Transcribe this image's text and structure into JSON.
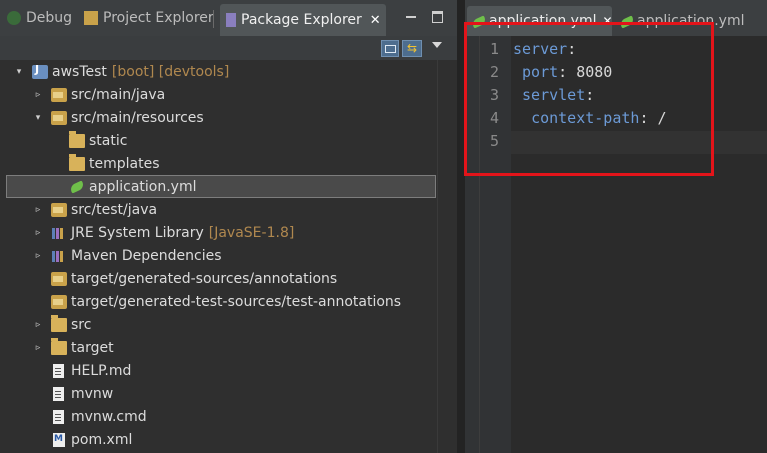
{
  "left_tabs": {
    "debug": "Debug",
    "project_explorer": "Project Explorer",
    "package_explorer": "Package Explorer",
    "close_glyph": "✕"
  },
  "tree": [
    {
      "label": "awsTest",
      "decoration": "[boot] [devtools]",
      "icon": "project-icon",
      "arrow": "▾",
      "indent": 0
    },
    {
      "label": "src/main/java",
      "icon": "source-folder-icon",
      "arrow": "▹",
      "indent": 1
    },
    {
      "label": "src/main/resources",
      "icon": "source-folder-icon",
      "arrow": "▾",
      "indent": 1
    },
    {
      "label": "static",
      "icon": "folder-icon",
      "arrow": "",
      "indent": 2
    },
    {
      "label": "templates",
      "icon": "folder-icon",
      "arrow": "",
      "indent": 2
    },
    {
      "label": "application.yml",
      "icon": "yml-file-icon",
      "arrow": "",
      "indent": 2,
      "selected": true
    },
    {
      "label": "src/test/java",
      "icon": "source-folder-icon",
      "arrow": "▹",
      "indent": 1
    },
    {
      "label": "JRE System Library",
      "decoration": "[JavaSE-1.8]",
      "icon": "library-icon",
      "arrow": "▹",
      "indent": 1
    },
    {
      "label": "Maven Dependencies",
      "icon": "library-icon",
      "arrow": "▹",
      "indent": 1
    },
    {
      "label": "target/generated-sources/annotations",
      "icon": "source-folder-icon",
      "arrow": "",
      "indent": 1
    },
    {
      "label": "target/generated-test-sources/test-annotations",
      "icon": "source-folder-icon",
      "arrow": "",
      "indent": 1
    },
    {
      "label": "src",
      "icon": "folder-icon",
      "arrow": "▹",
      "indent": 1
    },
    {
      "label": "target",
      "icon": "folder-icon",
      "arrow": "▹",
      "indent": 1
    },
    {
      "label": "HELP.md",
      "icon": "file-icon",
      "arrow": "",
      "indent": 1
    },
    {
      "label": "mvnw",
      "icon": "file-icon",
      "arrow": "",
      "indent": 1
    },
    {
      "label": "mvnw.cmd",
      "icon": "file-icon",
      "arrow": "",
      "indent": 1
    },
    {
      "label": "pom.xml",
      "icon": "pom-file-icon",
      "arrow": "",
      "indent": 1
    }
  ],
  "editor_tabs": [
    {
      "label": "application.yml",
      "close_glyph": "✕",
      "active": true
    },
    {
      "label": "application.yml",
      "active": false
    }
  ],
  "editor": {
    "lines": [
      {
        "number": "1",
        "indent": "",
        "key": "server",
        "sep": ":",
        "value": ""
      },
      {
        "number": "2",
        "indent": " ",
        "key": "port",
        "sep": ":",
        "value": " 8080"
      },
      {
        "number": "3",
        "indent": " ",
        "key": "servlet",
        "sep": ":",
        "value": ""
      },
      {
        "number": "4",
        "indent": "  ",
        "key": "context-path",
        "sep": ":",
        "value": " /"
      },
      {
        "number": "5",
        "indent": "",
        "key": "",
        "sep": "",
        "value": ""
      }
    ]
  },
  "colors": {
    "highlight_box": "#e3141a",
    "yaml_key": "#6c9ad6",
    "decoration": "#b0884f"
  }
}
